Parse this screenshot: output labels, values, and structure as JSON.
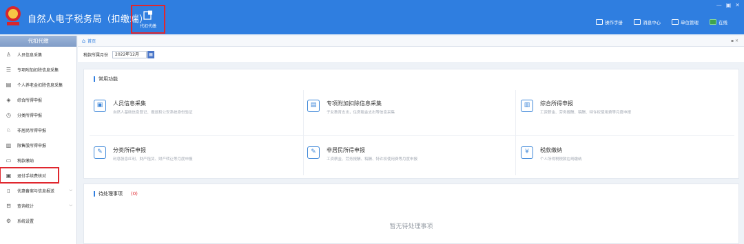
{
  "app": {
    "title": "自然人电子税务局（扣缴端）"
  },
  "module": {
    "label": "代扣代缴"
  },
  "window_controls": [
    "—",
    "▣",
    "✕"
  ],
  "top_links": [
    {
      "label": "操作手册",
      "icon": "book-icon"
    },
    {
      "label": "消息中心",
      "icon": "mail-icon"
    },
    {
      "label": "单位管理",
      "icon": "building-icon"
    },
    {
      "label": "在线",
      "icon": "monitor-icon"
    }
  ],
  "sidebar": {
    "header": "代扣代缴",
    "items": [
      {
        "label": "人员信息采集",
        "icon": "person-icon"
      },
      {
        "label": "专项附加扣除信息采集",
        "icon": "list-icon"
      },
      {
        "label": "个人养老金扣除信息采集",
        "icon": "document-icon"
      },
      {
        "label": "综合所得申报",
        "icon": "layers-icon"
      },
      {
        "label": "分类所得申报",
        "icon": "clock-icon"
      },
      {
        "label": "非居民所得申报",
        "icon": "person-outline-icon"
      },
      {
        "label": "限售股所得申报",
        "icon": "bar-chart-icon"
      },
      {
        "label": "税款缴纳",
        "icon": "wallet-icon"
      },
      {
        "label": "退付手续费核对",
        "icon": "check-document-icon"
      },
      {
        "label": "优惠备案与信息报送",
        "icon": "file-upload-icon"
      },
      {
        "label": "查询统计",
        "icon": "query-icon"
      },
      {
        "label": "系统设置",
        "icon": "gear-icon"
      }
    ]
  },
  "main": {
    "tab": {
      "label": "首页"
    },
    "period": {
      "label": "税款所属月份",
      "value": "2022年12月"
    },
    "common_functions": {
      "title": "常用功能",
      "cards": [
        {
          "title": "人员信息采集",
          "desc": "自然人基础信息登记、报送和公安系统身份验证",
          "icon": "id-card-icon"
        },
        {
          "title": "专项附加扣除信息采集",
          "desc": "子女教育支出，住房租金支出等信息采集",
          "icon": "monitor-card-icon"
        },
        {
          "title": "综合所得申报",
          "desc": "工资薪金、劳务报酬、稿酬、特许权使用费等月度申报",
          "icon": "report-icon"
        },
        {
          "title": "分类所得申报",
          "desc": "利息股息红利、财产租赁、财产转让等月度申报",
          "icon": "edit-icon"
        },
        {
          "title": "非居民所得申报",
          "desc": "工资薪金、劳务报酬、稿酬、特许权使用费等月度申报",
          "icon": "edit-icon"
        },
        {
          "title": "税款缴纳",
          "desc": "个人所得税税款在线缴纳",
          "icon": "payment-icon"
        }
      ]
    },
    "pending": {
      "title": "待处理事项",
      "count": "(0)",
      "empty_text": "暂无待处理事项"
    }
  }
}
